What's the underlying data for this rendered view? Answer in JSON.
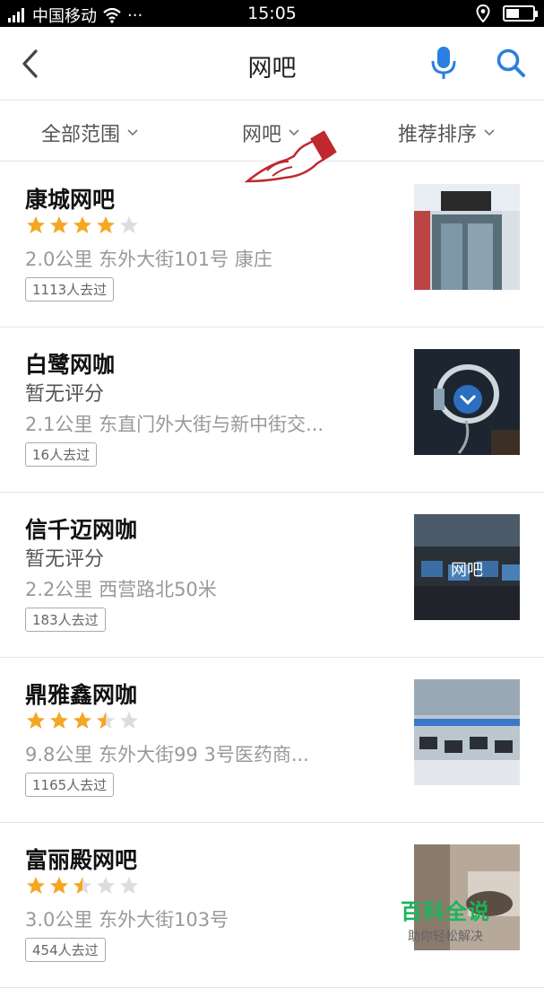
{
  "status_bar": {
    "carrier": "中国移动",
    "more": "···",
    "time": "15:05"
  },
  "header": {
    "title": "网吧"
  },
  "filters": [
    {
      "label": "全部范围"
    },
    {
      "label": "网吧"
    },
    {
      "label": "推荐排序"
    }
  ],
  "items": [
    {
      "name": "康城网吧",
      "rating_stars": 4,
      "rating_text": "",
      "address": "2.0公里  东外大街101号  康庄",
      "visits": "1113人去过",
      "thumb_label": ""
    },
    {
      "name": "白鹭网咖",
      "rating_stars": 0,
      "rating_text": "暂无评分",
      "address": "2.1公里  东直门外大街与新中街交...",
      "visits": "16人去过",
      "thumb_label": ""
    },
    {
      "name": "信千迈网咖",
      "rating_stars": 0,
      "rating_text": "暂无评分",
      "address": "2.2公里  西营路北50米",
      "visits": "183人去过",
      "thumb_label": "网吧"
    },
    {
      "name": "鼎雅鑫网咖",
      "rating_stars": 3.5,
      "rating_text": "",
      "address": "9.8公里  东外大街99  3号医药商...",
      "visits": "1165人去过",
      "thumb_label": ""
    },
    {
      "name": "富丽殿网吧",
      "rating_stars": 2.5,
      "rating_text": "",
      "address": "3.0公里  东外大街103号",
      "visits": "454人去过",
      "thumb_label": ""
    }
  ],
  "watermark": {
    "title": "百科全说",
    "subtitle": "助你轻松解决"
  },
  "colors": {
    "star_filled": "#f5a623",
    "star_empty": "#dddddd",
    "accent_blue": "#2b7fe0",
    "watermark_green": "#19b45a"
  }
}
